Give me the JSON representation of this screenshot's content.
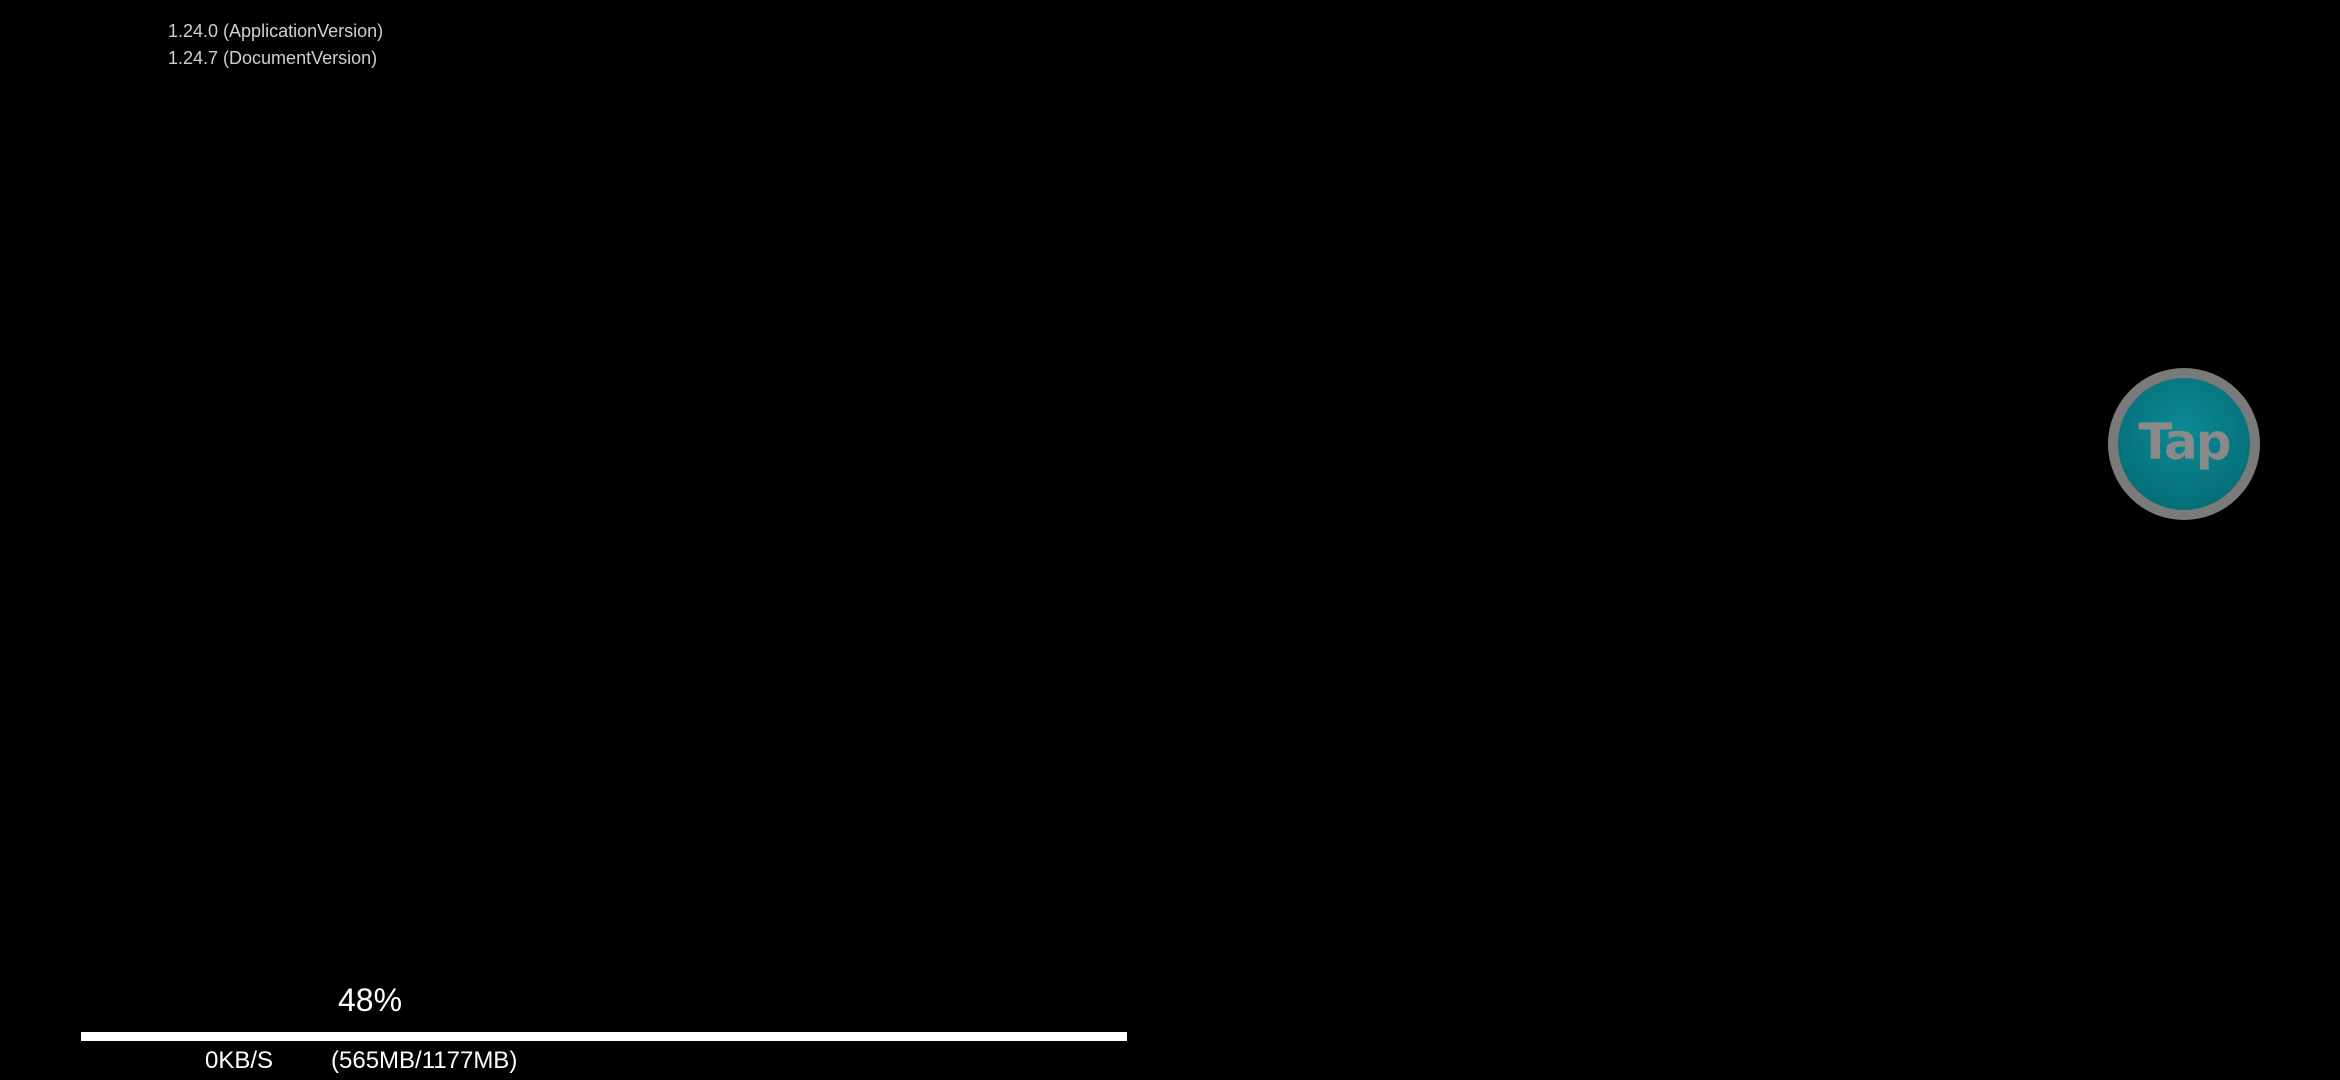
{
  "versions": {
    "application": "1.24.0 (ApplicationVersion)",
    "document": "1.24.7 (DocumentVersion)"
  },
  "tap_button": {
    "label": "Tap",
    "icon": "tap-button-icon",
    "ring_color": "#7a7a7a",
    "fill_color": "#06707a"
  },
  "download": {
    "percent_text": "48%",
    "progress": 0.48,
    "speed": "0KB/S",
    "size": "(565MB/1177MB)"
  }
}
